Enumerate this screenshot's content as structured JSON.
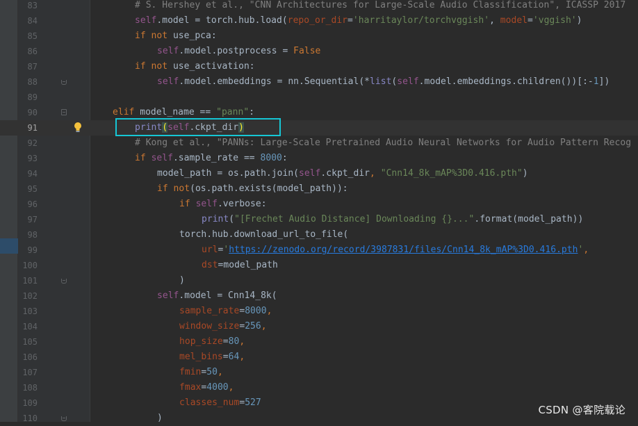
{
  "editor": {
    "lines": [
      {
        "n": "83"
      },
      {
        "n": "84"
      },
      {
        "n": "85"
      },
      {
        "n": "86"
      },
      {
        "n": "87"
      },
      {
        "n": "88"
      },
      {
        "n": "89"
      },
      {
        "n": "90"
      },
      {
        "n": "91"
      },
      {
        "n": "92"
      },
      {
        "n": "93"
      },
      {
        "n": "94"
      },
      {
        "n": "95"
      },
      {
        "n": "96"
      },
      {
        "n": "97"
      },
      {
        "n": "98"
      },
      {
        "n": "99"
      },
      {
        "n": "100"
      },
      {
        "n": "101"
      },
      {
        "n": "102"
      },
      {
        "n": "103"
      },
      {
        "n": "104"
      },
      {
        "n": "105"
      },
      {
        "n": "106"
      },
      {
        "n": "107"
      },
      {
        "n": "108"
      },
      {
        "n": "109"
      },
      {
        "n": "110"
      }
    ],
    "current_line": "91",
    "gutter_icons": [
      "lightbulb-icon",
      "fold-icon"
    ]
  },
  "code": {
    "l83": "# S. Hershey et al., \"CNN Architectures for Large-Scale Audio Classification\", ICASSP 2017",
    "l84_a": "self",
    "l84_b": ".model = torch.hub.load(",
    "l84_p1": "repo_or_dir",
    "l84_eq1": "=",
    "l84_s1": "'harritaylor/torchvggish'",
    "l84_c": ", ",
    "l84_p2": "model",
    "l84_eq2": "=",
    "l84_s2": "'vggish'",
    "l84_d": ")",
    "l85_kw": "if not",
    "l85_b": " use_pca:",
    "l86_self": "self",
    "l86_b": ".model.postprocess = ",
    "l86_kw": "False",
    "l87_kw": "if not",
    "l87_b": " use_activation:",
    "l88_self": "self",
    "l88_b": ".model.embeddings = nn.Sequential(*",
    "l88_bi": "list",
    "l88_c": "(",
    "l88_self2": "self",
    "l88_d": ".model.embeddings.children())[:-",
    "l88_num": "1",
    "l88_e": "])",
    "l90_kw": "elif",
    "l90_b": " model_name == ",
    "l90_s": "\"pann\"",
    "l90_c": ":",
    "l91_a": "print",
    "l91_paren_open": "(",
    "l91_self": "self",
    "l91_b": ".ckpt_dir",
    "l91_paren_close": ")",
    "l92": "# Kong et al., \"PANNs: Large-Scale Pretrained Audio Neural Networks for Audio Pattern Recog",
    "l93_kw": "if",
    "l93_sp": " ",
    "l93_self": "self",
    "l93_b": ".sample_rate == ",
    "l93_num": "8000",
    "l93_c": ":",
    "l94_a": "model_path = os.path.join(",
    "l94_self": "self",
    "l94_b": ".ckpt_dir",
    "l94_comma": ", ",
    "l94_s": "\"Cnn14_8k_mAP%3D0.416.pth\"",
    "l94_c": ")",
    "l95_kw": "if",
    "l95_kw2": " not",
    "l95_b": "(os.path.exists(model_path)):",
    "l96_kw": "if",
    "l96_sp": " ",
    "l96_self": "self",
    "l96_b": ".verbose:",
    "l97_bi": "print",
    "l97_a": "(",
    "l97_s": "\"[Frechet Audio Distance] Downloading {}...\"",
    "l97_b": ".format(model_path))",
    "l98": "torch.hub.download_url_to_file(",
    "l99_p": "url",
    "l99_eq": "=",
    "l99_q1": "'",
    "l99_link": "https://zenodo.org/record/3987831/files/Cnn14_8k_mAP%3D0.416.pth",
    "l99_q2": "'",
    "l99_c": ",",
    "l100_p": "dst",
    "l100_b": "=model_path",
    "l101": ")",
    "l102_self": "self",
    "l102_b": ".model = Cnn14_8k(",
    "l103_p": "sample_rate",
    "l103_eq": "=",
    "l103_num": "8000",
    "l103_c": ",",
    "l104_p": "window_size",
    "l104_eq": "=",
    "l104_num": "256",
    "l104_c": ",",
    "l105_p": "hop_size",
    "l105_eq": "=",
    "l105_num": "80",
    "l105_c": ",",
    "l106_p": "mel_bins",
    "l106_eq": "=",
    "l106_num": "64",
    "l106_c": ",",
    "l107_p": "fmin",
    "l107_eq": "=",
    "l107_num": "50",
    "l107_c": ",",
    "l108_p": "fmax",
    "l108_eq": "=",
    "l108_num": "4000",
    "l108_c": ",",
    "l109_p": "classes_num",
    "l109_eq": "=",
    "l109_num": "527",
    "l110": ")"
  },
  "watermark": "CSDN @客院载论",
  "colors": {
    "background": "#2b2b2b",
    "gutter": "#313335",
    "keyword": "#cc7832",
    "self": "#94558d",
    "string": "#6a8759",
    "number": "#6897bb",
    "param": "#aa4926",
    "comment": "#808080",
    "link": "#287bde",
    "highlight_box": "#16c7d6"
  }
}
